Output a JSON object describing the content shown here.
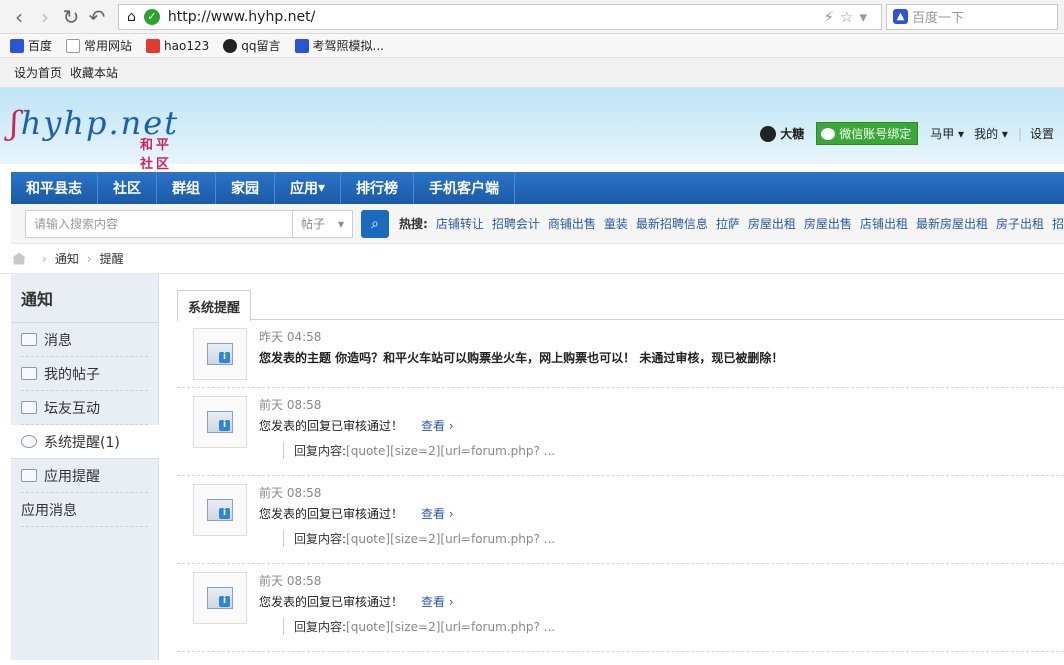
{
  "browser": {
    "url": "http://www.hyhp.net/",
    "search_placeholder": "百度一下"
  },
  "bookmarks": [
    "百度",
    "常用网站",
    "hao123",
    "qq留言",
    "考驾照模拟..."
  ],
  "top_links": [
    "设为首页",
    "收藏本站"
  ],
  "header": {
    "logo_text": "hyhp.net",
    "logo_sub": "和平社区",
    "username": "大糖",
    "wechat_button": "微信账号绑定",
    "links": [
      "马甲",
      "我的",
      "设置"
    ]
  },
  "nav": [
    "和平县志",
    "社区",
    "群组",
    "家园",
    "应用",
    "排行榜",
    "手机客户端"
  ],
  "search": {
    "placeholder": "请输入搜索内容",
    "type": "帖子",
    "hot_label": "热搜:",
    "hot_terms": [
      "店铺转让",
      "招聘会计",
      "商铺出售",
      "童装",
      "最新招聘信息",
      "拉萨",
      "房屋出租",
      "房屋出售",
      "店铺出租",
      "最新房屋出租",
      "房子出租",
      "招"
    ]
  },
  "breadcrumb": [
    "通知",
    "提醒"
  ],
  "sidebar": {
    "title": "通知",
    "items": [
      "消息",
      "我的帖子",
      "坛友互动",
      "系统提醒(1)",
      "应用提醒",
      "应用消息"
    ]
  },
  "tab_label": "系统提醒",
  "notices": [
    {
      "time": "昨天 04:58",
      "text": "您发表的主题 你造吗？和平火车站可以购票坐火车，网上购票也可以！ 未通过审核，现已被删除！"
    },
    {
      "time": "前天 08:58",
      "text": "您发表的回复已审核通过！",
      "view": "查看 ›",
      "quote_label": "回复内容:",
      "quote": "[quote][size=2][url=forum.php? ..."
    },
    {
      "time": "前天 08:58",
      "text": "您发表的回复已审核通过！",
      "view": "查看 ›",
      "quote_label": "回复内容:",
      "quote": "[quote][size=2][url=forum.php? ..."
    },
    {
      "time": "前天 08:58",
      "text": "您发表的回复已审核通过！",
      "view": "查看 ›",
      "quote_label": "回复内容:",
      "quote": "[quote][size=2][url=forum.php? ..."
    }
  ]
}
